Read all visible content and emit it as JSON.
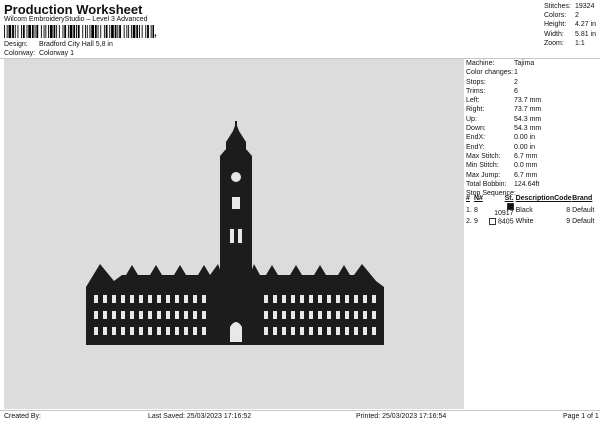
{
  "header": {
    "title": "Production Worksheet",
    "subtitle": "Wilcom EmbroideryStudio – Level 3 Advanced",
    "barcode_mark": ","
  },
  "meta": [
    {
      "label": "Design:",
      "value": "Bradford City Hall 5,8 in"
    },
    {
      "label": "Colorway:",
      "value": "Colorway 1"
    }
  ],
  "stats": [
    {
      "label": "Stitches:",
      "value": "19324"
    },
    {
      "label": "Colors:",
      "value": "2"
    },
    {
      "label": "Height:",
      "value": "4.27 in"
    },
    {
      "label": "Width:",
      "value": "5.81 in"
    },
    {
      "label": "Zoom:",
      "value": "1:1"
    }
  ],
  "machine": [
    {
      "label": "Machine:",
      "value": "Tajima"
    },
    {
      "label": "Color changes:",
      "value": "1"
    },
    {
      "label": "Stops:",
      "value": "2"
    },
    {
      "label": "Trims:",
      "value": "6"
    },
    {
      "label": "Left:",
      "value": "73.7 mm"
    },
    {
      "label": "Right:",
      "value": "73.7 mm"
    },
    {
      "label": "Up:",
      "value": "54.3 mm"
    },
    {
      "label": "Down:",
      "value": "54.3 mm"
    },
    {
      "label": "EndX:",
      "value": "0.00 in"
    },
    {
      "label": "EndY:",
      "value": "0.00 in"
    },
    {
      "label": "Max Stitch:",
      "value": "6.7 mm"
    },
    {
      "label": "Min Stitch:",
      "value": "0.0 mm"
    },
    {
      "label": "Max Jump:",
      "value": "6.7 mm"
    },
    {
      "label": "Total Bobbin:",
      "value": "124.64ft"
    },
    {
      "label": "Stop Sequence:",
      "value": ""
    }
  ],
  "stop_table": {
    "headers": [
      "#",
      "N#",
      "St.",
      "Description",
      "Code",
      "Brand"
    ],
    "rows": [
      {
        "num": "1.",
        "needle": "8",
        "swatch": "#111111",
        "stitches": "10917",
        "description": "Black",
        "code": "8",
        "brand": "Default"
      },
      {
        "num": "2.",
        "needle": "9",
        "swatch": "#ffffff",
        "stitches": "8405",
        "description": "White",
        "code": "9",
        "brand": "Default"
      }
    ]
  },
  "footer": {
    "created_by": "Created By:",
    "last_saved": "Last Saved: 25/03/2023 17:16:52",
    "printed": "Printed: 25/03/2023 17:16:54",
    "page": "Page 1 of 1"
  },
  "colors": {
    "design_bg": "#dcdcdc",
    "thread_black": "#1c1c1c",
    "thread_white": "#e8e8e8"
  }
}
